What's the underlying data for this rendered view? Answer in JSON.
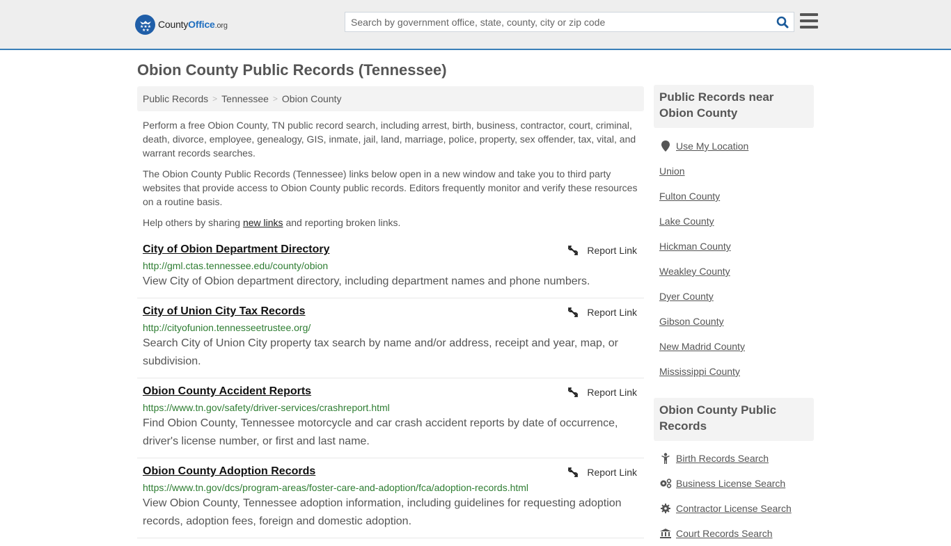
{
  "header": {
    "logo": {
      "prefix": "County",
      "brand": "Office",
      "tld": ".org"
    },
    "search": {
      "placeholder": "Search by government office, state, county, city or zip code",
      "value": ""
    },
    "search_icon": "search-icon",
    "menu_icon": "hamburger-menu-icon",
    "accent_color": "#3a7fb8"
  },
  "main": {
    "title": "Obion County Public Records (Tennessee)",
    "breadcrumb": [
      {
        "label": "Public Records"
      },
      {
        "label": "Tennessee"
      },
      {
        "label": "Obion County"
      }
    ],
    "breadcrumb_separator": ">",
    "intro": {
      "p1": "Perform a free Obion County, TN public record search, including arrest, birth, business, contractor, court, criminal, death, divorce, employee, genealogy, GIS, inmate, jail, land, marriage, police, property, sex offender, tax, vital, and warrant records searches.",
      "p2": "The Obion County Public Records (Tennessee) links below open in a new window and take you to third party websites that provide access to Obion County public records. Editors frequently monitor and verify these resources on a routine basis.",
      "p3_before": "Help others by sharing ",
      "p3_link": "new links",
      "p3_after": " and reporting broken links."
    },
    "report_label": "Report Link",
    "results": [
      {
        "title": "City of Obion Department Directory",
        "url": "http://gml.ctas.tennessee.edu/county/obion",
        "description": "View City of Obion department directory, including department names and phone numbers."
      },
      {
        "title": "City of Union City Tax Records",
        "url": "http://cityofunion.tennesseetrustee.org/",
        "description": "Search City of Union City property tax search by name and/or address, receipt and year, map, or subdivision."
      },
      {
        "title": "Obion County Accident Reports",
        "url": "https://www.tn.gov/safety/driver-services/crashreport.html",
        "description": "Find Obion County, Tennessee motorcycle and car crash accident reports by date of occurrence, driver's license number, or first and last name."
      },
      {
        "title": "Obion County Adoption Records",
        "url": "https://www.tn.gov/dcs/program-areas/foster-care-and-adoption/fca/adoption-records.html",
        "description": "View Obion County, Tennessee adoption information, including guidelines for requesting adoption records, adoption fees, foreign and domestic adoption."
      }
    ]
  },
  "sidebar": {
    "nearby": {
      "title": "Public Records near Obion County",
      "use_location": "Use My Location",
      "items": [
        "Union",
        "Fulton County",
        "Lake County",
        "Hickman County",
        "Weakley County",
        "Dyer County",
        "Gibson County",
        "New Madrid County",
        "Mississippi County"
      ]
    },
    "county_records": {
      "title": "Obion County Public Records",
      "items": [
        {
          "label": "Birth Records Search",
          "icon": "child-icon"
        },
        {
          "label": "Business License Search",
          "icon": "cogs-icon"
        },
        {
          "label": "Contractor License Search",
          "icon": "gear-icon"
        },
        {
          "label": "Court Records Search",
          "icon": "courthouse-icon"
        }
      ]
    }
  }
}
